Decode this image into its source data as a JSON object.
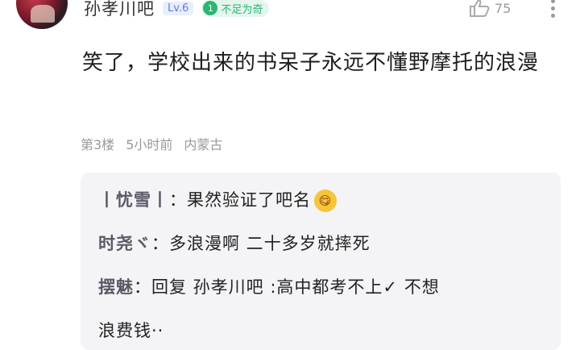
{
  "header": {
    "username": "孙孝川吧",
    "level": "Lv.6",
    "badge_icon": "1",
    "badge_text": "不足为奇",
    "like_count": "75"
  },
  "post": {
    "text": "笑了，学校出来的书呆子永远不懂野摩托的浪漫"
  },
  "meta": {
    "floor": "第3楼",
    "time": "5小时前",
    "location": "内蒙古"
  },
  "replies": [
    {
      "name": "丨忧雪丨",
      "sep": "：",
      "text": "果然验证了吧名",
      "emoji": "😋"
    },
    {
      "name": "时尧ヾ",
      "sep": "：",
      "text": "多浪漫啊 二十多岁就摔死"
    },
    {
      "name": "摆魅",
      "sep": "：",
      "text": "回复 孙孝川吧 :高中都考不上✓ 不想"
    },
    {
      "name": "",
      "sep": "",
      "text": "浪费钱··"
    }
  ],
  "colors": {
    "badge_green": "#2bb673",
    "level_blue": "#5b7fd6",
    "reply_bg": "#f4f4f7"
  }
}
